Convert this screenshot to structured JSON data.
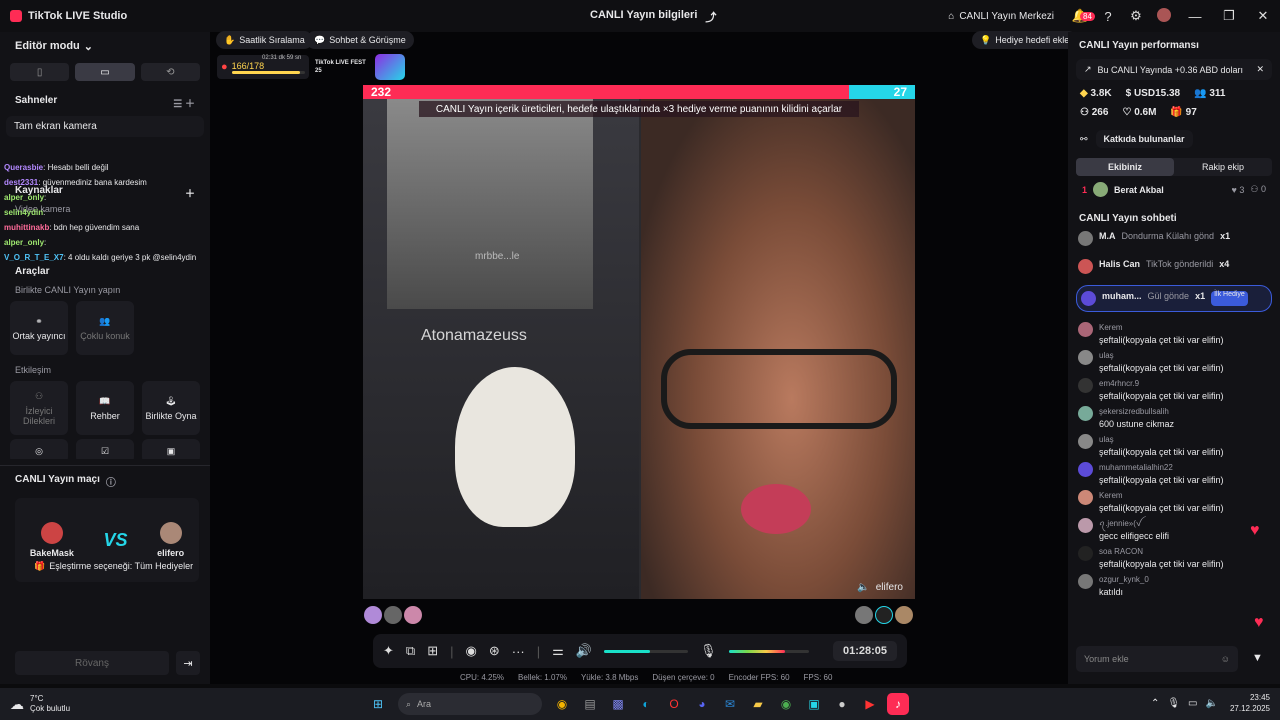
{
  "titlebar": {
    "app_name": "TikTok LIVE Studio",
    "center_title": "CANLI Yayın bilgileri",
    "center_link": "CANLI Yayın Merkezi",
    "notif_count": "84"
  },
  "left": {
    "editor_mode": "Editör modu",
    "scenes_title": "Sahneler",
    "scene_item": "Tam ekran kamera",
    "sources_title": "Kaynaklar",
    "sources_item": "Video kamera",
    "tools_title": "Araçlar",
    "collab_title": "Birlikte CANLI Yayın yapın",
    "tile_cohost": "Ortak yayıncı",
    "tile_multi": "Çoklu konuk",
    "interaction_title": "Etkileşim",
    "tile_viewer_req": "İzleyici Dilekleri",
    "tile_guide": "Rehber",
    "tile_play": "Birlikte Oyna",
    "match_title": "CANLI Yayın maçı",
    "match_player1": "BakeMask",
    "match_player2": "elifero",
    "match_vs": "VS",
    "match_option": "Eşleştirme seçeneği: Tüm Hediyeler",
    "rematch": "Rövanş"
  },
  "overlay_chat": [
    {
      "user": "Querasbie",
      "text": ": Hesabı belli değil"
    },
    {
      "user": "dest2331",
      "text": ": güvenmediniz bana kardesim"
    },
    {
      "user": "alper_only",
      "text": ":"
    },
    {
      "user": "selin4ydin",
      "text": ":"
    },
    {
      "user": "muhittinakb",
      "text": ": bdn hep güvendim sana"
    },
    {
      "user": "alper_only",
      "text": ":"
    },
    {
      "user": "V_O_R_T_E_X7",
      "text": ": 4 oldu kaldı geriye 3 pk @selin4ydin"
    }
  ],
  "stage": {
    "chip_hourly": "Saatlik Sıralama",
    "chip_chat": "Sohbet & Görüşme",
    "gift_goal": "Hediye hedefi ekle",
    "progress": "166/178",
    "progress_fraction": 0.93,
    "timer_small": "02:31 dk 59 sn",
    "fest_label": "TikTok LIVE FEST 25",
    "score_left": "232",
    "score_right": "27",
    "banner_text": "CANLI Yayın içerik üreticileri, hedefe ulaştıklarında ×3 hediye verme puanının kilidini açarlar",
    "left_cam_label": "Atonamazeuss",
    "watermark": "mrbbe...le",
    "right_cam_label": "elifero",
    "duration": "01:28:05",
    "mic_level": 0.7,
    "vol_level": 0.55
  },
  "stats": {
    "cpu": "CPU: 4.25%",
    "mem": "Bellek: 1.07%",
    "upload": "Yükle: 3.8 Mbps",
    "dropped": "Düşen çerçeve: 0",
    "encoder_fps": "Encoder FPS: 60",
    "fps": "FPS: 60"
  },
  "right": {
    "perf_title": "CANLI Yayın performansı",
    "perf_note": "Bu CANLI Yayında +0.36 ABD doları",
    "diamonds": "3.8K",
    "usd": "USD15.38",
    "viewers_count": "311",
    "likes_a": "266",
    "likes_b": "0.6M",
    "gifts_count": "97",
    "contributors": "Katkıda bulunanlar",
    "tab_team": "Ekibiniz",
    "tab_opp": "Rakip ekip",
    "rank1_num": "1",
    "rank1_name": "Berat Akbal",
    "rank1_a": "3",
    "rank1_b": "0",
    "chat_title": "CANLI Yayın sohbeti",
    "gift_rows": [
      {
        "user": "M.A",
        "text": "Dondurma Külahı gönd",
        "count": "x1"
      },
      {
        "user": "Halis Can",
        "text": "TikTok gönderildi",
        "count": "x4"
      },
      {
        "user": "muham...",
        "text": "Gül gönde",
        "count": "x1",
        "tag": "İlk Hediye"
      }
    ],
    "chat": [
      {
        "user": "Kerem",
        "text": "şeftali(kopyala çet tiki var elifin)"
      },
      {
        "user": "ulaş",
        "text": "şeftali(kopyala çet tiki var elifin)"
      },
      {
        "user": "em4rhncr.9",
        "text": "şeftali(kopyala çet tiki var elifin)"
      },
      {
        "user": "şekersizredbullsalih",
        "text": "600 ustune cikmaz"
      },
      {
        "user": "ulaş",
        "text": "şeftali(kopyala çet tiki var elifin)"
      },
      {
        "user": "muhammetalialhin22",
        "text": "şeftali(kopyala çet tiki var elifin)"
      },
      {
        "user": "Kerem",
        "text": "şeftali(kopyala çet tiki var elifin)"
      },
      {
        "user": "ꪖ.jennie»(ꪜ",
        "text": "gecc elifigecc elifi"
      },
      {
        "user": "soa RACON",
        "text": "şeftali(kopyala çet tiki var elifin)"
      },
      {
        "user": "ozgur_kynk_0",
        "text": "katıldı"
      }
    ],
    "comment_placeholder": "Yorum ekle"
  },
  "taskbar": {
    "weather_temp": "7°C",
    "weather_desc": "Çok bulutlu",
    "search_placeholder": "Ara",
    "time": "23:45",
    "date": "27.12.2025"
  },
  "colors": {
    "accent": "#fe2c55",
    "teal": "#25d6e8"
  }
}
